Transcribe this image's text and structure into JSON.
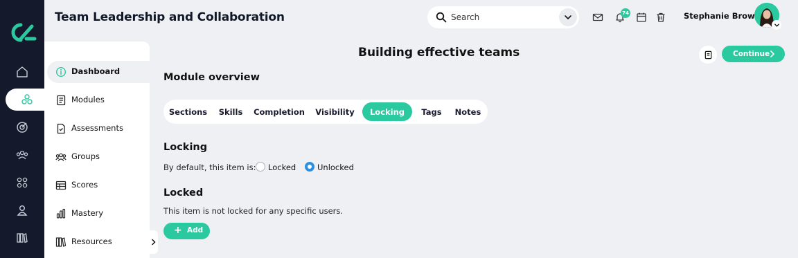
{
  "app": {
    "title": "Team Leadership and Collaboration"
  },
  "search": {
    "placeholder": "Search"
  },
  "notifications": {
    "count": "74"
  },
  "user": {
    "name": "Stephanie Brown"
  },
  "rail": {
    "items": [
      {
        "icon": "home-icon"
      },
      {
        "icon": "modules-cluster-icon",
        "active": true
      },
      {
        "icon": "target-icon"
      },
      {
        "icon": "people-icon"
      },
      {
        "icon": "grid-icon"
      },
      {
        "icon": "person-icon"
      },
      {
        "icon": "library-icon"
      }
    ]
  },
  "sidebar": {
    "items": [
      {
        "label": "Dashboard",
        "icon": "info-icon",
        "active": true
      },
      {
        "label": "Modules",
        "icon": "book-icon"
      },
      {
        "label": "Assessments",
        "icon": "document-check-icon"
      },
      {
        "label": "Groups",
        "icon": "group-icon"
      },
      {
        "label": "Scores",
        "icon": "table-icon"
      },
      {
        "label": "Mastery",
        "icon": "bar-chart-icon"
      },
      {
        "label": "Resources",
        "icon": "books-icon"
      }
    ]
  },
  "page": {
    "title": "Building effective teams",
    "continue_label": "Continue",
    "overview_heading": "Module overview"
  },
  "tabs": [
    {
      "label": "Sections"
    },
    {
      "label": "Skills"
    },
    {
      "label": "Completion"
    },
    {
      "label": "Visibility"
    },
    {
      "label": "Locking",
      "active": true
    },
    {
      "label": "Tags"
    },
    {
      "label": "Notes"
    }
  ],
  "locking": {
    "heading": "Locking",
    "default_text": "By default, this item is:",
    "options": [
      {
        "label": "Locked",
        "selected": false
      },
      {
        "label": "Unlocked",
        "selected": true
      }
    ]
  },
  "locked": {
    "heading": "Locked",
    "note": "This item is not locked for any specific users.",
    "add_label": "Add"
  },
  "colors": {
    "accent": "#2bc9a0",
    "rail": "#141a2b",
    "background": "#eef0f4",
    "radio": "#2d8fe0"
  }
}
